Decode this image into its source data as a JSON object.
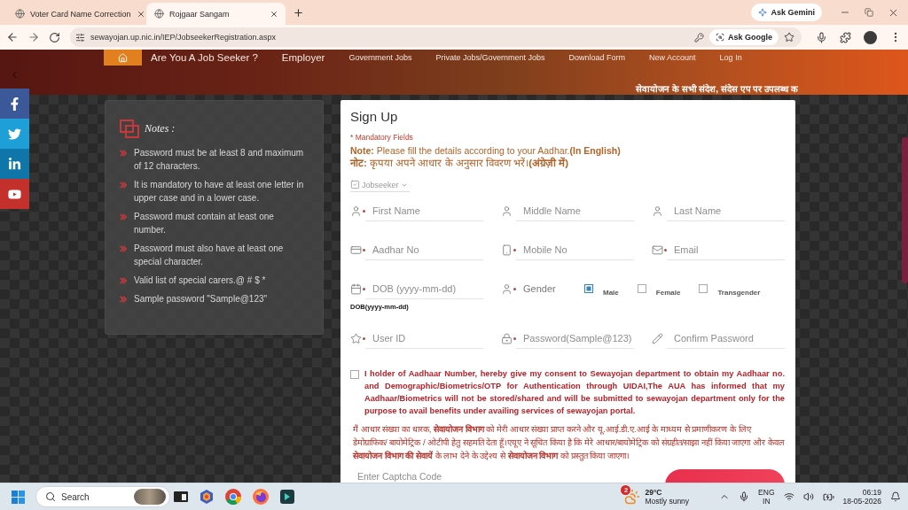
{
  "browser": {
    "tabs": [
      {
        "title": "Voter Card Name Correction",
        "selected": false
      },
      {
        "title": "Rojgaar Sangam",
        "selected": true
      }
    ],
    "gemini": "Ask Gemini",
    "url": "sewayojan.up.nic.in/IEP/JobseekerRegistration.aspx",
    "ask_google": "Ask Google"
  },
  "header": {
    "nav": [
      {
        "label": "Are You A Job Seeker ?",
        "kind": "main"
      },
      {
        "label": "Employer",
        "kind": "main"
      },
      {
        "label": "Government Jobs",
        "kind": "sub"
      },
      {
        "label": "Private Jobs/Government Jobs",
        "kind": "sub"
      },
      {
        "label": "Download Form",
        "kind": "sub"
      },
      {
        "label": "New Account",
        "kind": "sub"
      },
      {
        "label": "Log In",
        "kind": "sub"
      }
    ],
    "ticker": "सेवायोजन के सभी संदेश, संदेस एप पर उपलब्ध क"
  },
  "notes": {
    "title": "Notes :",
    "items": [
      "Password must be at least 8 and maximum of 12 characters.",
      "It is mandatory to have at least one letter in upper case and in a lower case.",
      "Password must contain at least one number.",
      "Password must also have at least one special character.",
      "Valid list of special carers.@ # $ *",
      "Sample password \"Sample@123\""
    ]
  },
  "form": {
    "title": "Sign Up",
    "mandatory": "* Mandatory Fields",
    "note_en": "**Note:** Please fill the details according to your Aadhar.**(In English)**",
    "note_hi": "**नोट:** कृपया अपने आधार के अनुसार विवरण भरें।**(अंग्रेज़ी में)**",
    "user_type": "Jobseeker",
    "fields": [
      {
        "kind": "input",
        "placeholder": "First Name",
        "required": true
      },
      {
        "kind": "input",
        "placeholder": "Middle Name",
        "required": false
      },
      {
        "kind": "input",
        "placeholder": "Last Name",
        "required": false
      },
      {
        "kind": "input",
        "placeholder": "Aadhar No",
        "required": true
      },
      {
        "kind": "input",
        "placeholder": "Mobile No",
        "required": true
      },
      {
        "kind": "input",
        "placeholder": "Email",
        "required": true
      },
      {
        "kind": "input",
        "placeholder": "DOB (yyyy-mm-dd)",
        "required": true,
        "hint": "DOB(yyyy-mm-dd)"
      },
      {
        "kind": "choice",
        "label": "Gender",
        "required": true,
        "options": [
          {
            "label": "Male",
            "selected": true
          },
          {
            "label": "Female",
            "selected": false
          },
          {
            "label": "Transgender",
            "selected": false
          }
        ]
      },
      {
        "kind": "input",
        "placeholder": "User ID",
        "required": true
      },
      {
        "kind": "input",
        "placeholder": "Password(Sample@123)",
        "required": true
      },
      {
        "kind": "input",
        "placeholder": "Confirm Password",
        "required": false
      }
    ],
    "consent": {
      "checked": false,
      "text": "I holder of Aadhaar Number, hereby give my consent to Sewayojan department to obtain my Aadhaar no. and Demographic/Biometrics/OTP for Authentication through UIDAI,The AUA has informed that my Aadhaar/Biometrics will not be stored/shared and will be submitted to sewayojan department only for the purpose to avail benefits under availing services of sewayojan portal."
    },
    "consent_hi": "मैं आधार संख्या का धारक, **सेवायोजन विभाग** को मेरी आधार संख्या प्राप्त करने और यू.आई.डी.ए.आई के माध्यम से प्रमाणीकरण के लिए डेमोग्राफिक/ बायोमेट्रिक / ओटीपी हेतु सहमति देता हूँ।एयूए ने सूचित किया है कि मेरे आधार/बायोमेट्रिक को संग्रहीत/साझा नहीं किया जाएगा और केवल **सेवायोजन विभाग की सेवायें** के लाभ देने के उद्देश्य से **सेवायोजन विभाग** को प्रस्तुत किया जाएगा।",
    "captcha": {
      "placeholder": "Enter Captcha Code"
    }
  },
  "taskbar": {
    "search": {
      "label": "Search"
    },
    "weather": {
      "temperature": "29°C",
      "condition": "Mostly sunny",
      "badge": "2"
    },
    "language": "ENG",
    "region": "IN",
    "time": "06:19",
    "date": "18-05-2026"
  }
}
